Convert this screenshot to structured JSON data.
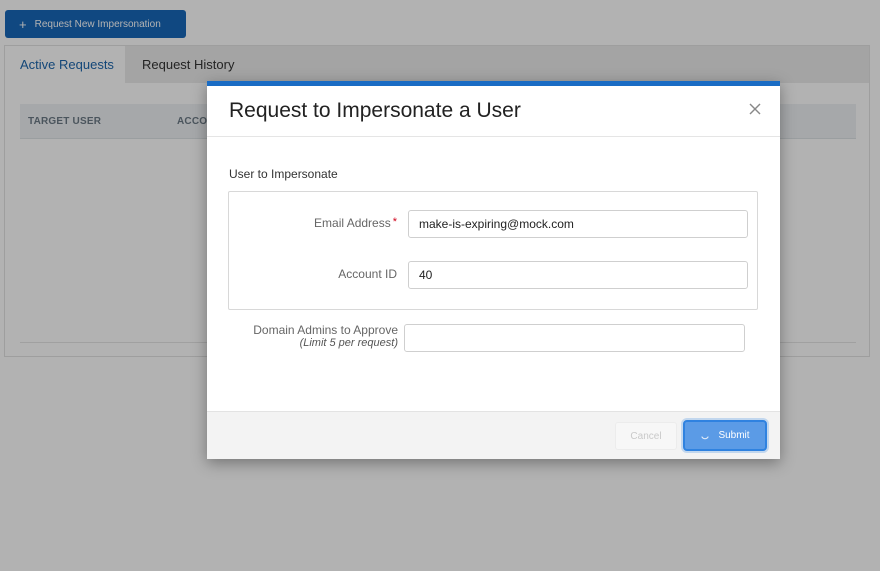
{
  "toolbar": {
    "request_new_label": "Request New Impersonation",
    "plus_icon": "+"
  },
  "tabs": [
    {
      "label": "Active Requests",
      "active": true
    },
    {
      "label": "Request History",
      "active": false
    }
  ],
  "table": {
    "columns": [
      "TARGET USER",
      "ACCO"
    ]
  },
  "modal": {
    "title": "Request to Impersonate a User",
    "close_icon": "close-icon",
    "section_label": "User to Impersonate",
    "email": {
      "label": "Email Address",
      "required_marker": "*",
      "value": "make-is-expiring@mock.com"
    },
    "account_id": {
      "label": "Account ID",
      "value": "40"
    },
    "domain_admins": {
      "label": "Domain Admins to Approve",
      "sublabel": "(Limit 5 per request)",
      "value": ""
    },
    "footer": {
      "cancel_label": "Cancel",
      "submit_label": "Submit",
      "submit_loading": true
    }
  },
  "colors": {
    "accent": "#1a6cc4",
    "primary_button": "#1767b9",
    "submit_button": "#5b9be6",
    "required": "#d0021b"
  }
}
